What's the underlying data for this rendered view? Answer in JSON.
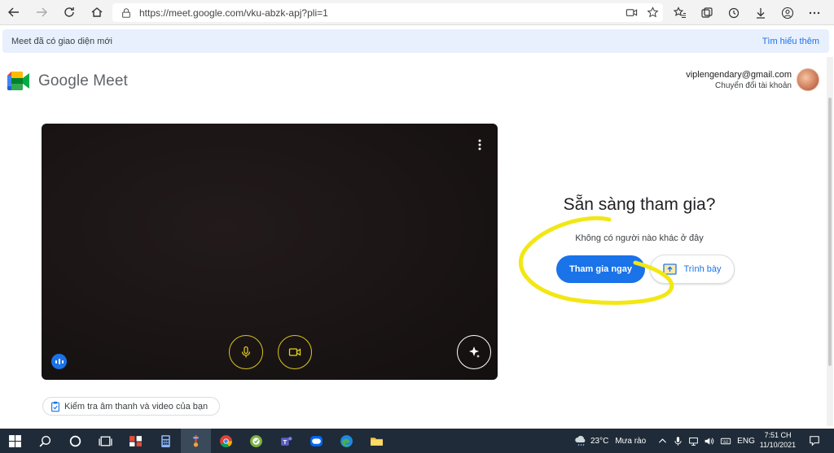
{
  "browser": {
    "url": "https://meet.google.com/vku-abzk-apj?pli=1"
  },
  "banner": {
    "message": "Meet đã có giao diện mới",
    "link": "Tìm hiểu thêm"
  },
  "header": {
    "app_name": "Google Meet",
    "email": "viplengendary@gmail.com",
    "switch_account": "Chuyển đổi tài khoản"
  },
  "join": {
    "title": "Sẵn sàng tham gia?",
    "subtitle": "Không có người nào khác ở đây",
    "join_label": "Tham gia ngay",
    "present_label": "Trình bày"
  },
  "check_av": {
    "label": "Kiểm tra âm thanh và video của bạn"
  },
  "taskbar": {
    "weather_temp": "23°C",
    "weather_desc": "Mưa rào",
    "language": "ENG",
    "time": "7:51 CH",
    "date": "11/10/2021"
  },
  "colors": {
    "accent": "#1a73e8",
    "annotation": "#f2e713",
    "taskbar": "#1f2b38"
  }
}
